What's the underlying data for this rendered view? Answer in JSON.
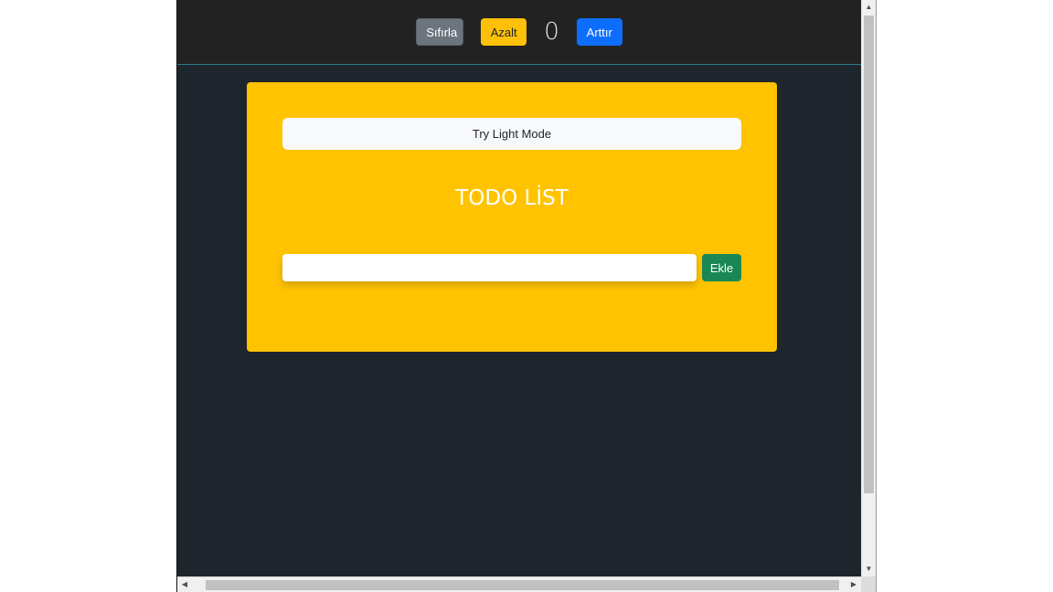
{
  "navbar": {
    "reset_label": "Sıfırla",
    "decrement_label": "Azalt",
    "count": "0",
    "increment_label": "Arttır"
  },
  "todo": {
    "mode_toggle_label": "Try Light Mode",
    "title": "TODO LİST",
    "input_value": "",
    "input_placeholder": "",
    "add_label": "Ekle"
  },
  "colors": {
    "card_background": "#ffc300",
    "page_background": "#1f252d",
    "navbar_background": "#222222",
    "reset_button": "#6c757d",
    "decrement_button": "#ffc107",
    "increment_button": "#0d6efd",
    "add_button": "#198754"
  },
  "icons": {
    "scroll_up": "triangle-up-icon",
    "scroll_down": "triangle-down-icon",
    "scroll_left": "triangle-left-icon",
    "scroll_right": "triangle-right-icon"
  }
}
